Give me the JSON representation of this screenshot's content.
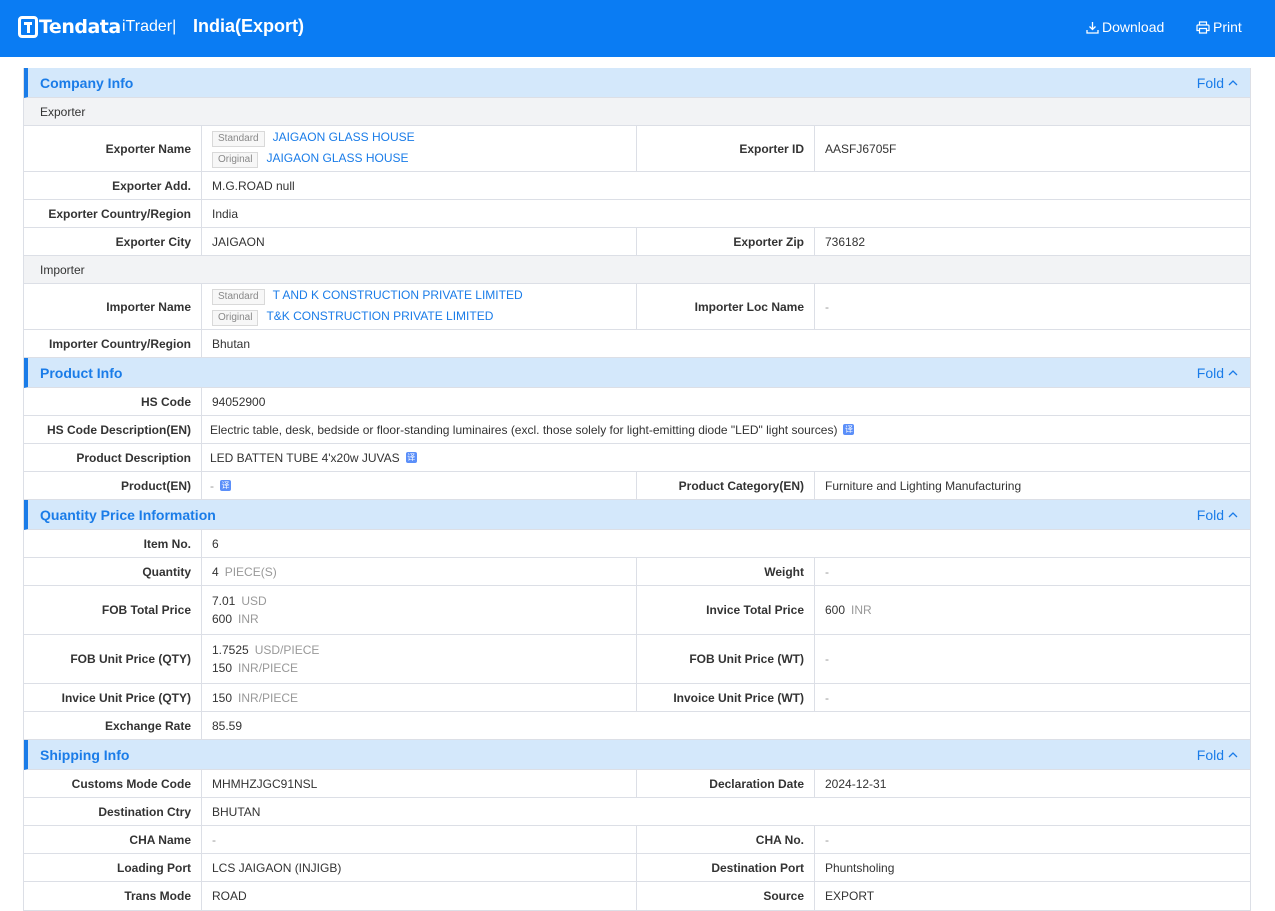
{
  "header": {
    "logo_text": "Tendata",
    "product": "iTrader|",
    "title": "India(Export)",
    "download_label": "Download",
    "print_label": "Print",
    "bar_color": "#0a7cf3"
  },
  "fold_label": "Fold",
  "tag_standard": "Standard",
  "tag_original": "Original",
  "translate_glyph": "译",
  "company": {
    "title": "Company Info",
    "exporter_sub": "Exporter",
    "exporter_name_label": "Exporter Name",
    "exporter_name_std": "JAIGAON GLASS HOUSE",
    "exporter_name_orig": "JAIGAON GLASS HOUSE",
    "exporter_id_label": "Exporter ID",
    "exporter_id": "AASFJ6705F",
    "exporter_add_label": "Exporter Add.",
    "exporter_add": "M.G.ROAD null",
    "exporter_country_label": "Exporter Country/Region",
    "exporter_country": "India",
    "exporter_city_label": "Exporter City",
    "exporter_city": "JAIGAON",
    "exporter_zip_label": "Exporter Zip",
    "exporter_zip": "736182",
    "importer_sub": "Importer",
    "importer_name_label": "Importer Name",
    "importer_name_std": "T AND K CONSTRUCTION PRIVATE LIMITED",
    "importer_name_orig": "T&K CONSTRUCTION PRIVATE LIMITED",
    "importer_loc_label": "Importer Loc Name",
    "importer_loc": "-",
    "importer_country_label": "Importer Country/Region",
    "importer_country": "Bhutan"
  },
  "product": {
    "title": "Product Info",
    "hs_code_label": "HS Code",
    "hs_code": "94052900",
    "hs_desc_label": "HS Code Description(EN)",
    "hs_desc": "Electric table, desk, bedside or floor-standing luminaires (excl. those solely for light-emitting diode \"LED\" light sources)",
    "prod_desc_label": "Product Description",
    "prod_desc": "LED BATTEN TUBE 4'x20w JUVAS",
    "product_en_label": "Product(EN)",
    "product_en": "-",
    "category_label": "Product Category(EN)",
    "category": "Furniture and Lighting Manufacturing"
  },
  "quantity": {
    "title": "Quantity Price Information",
    "item_no_label": "Item No.",
    "item_no": "6",
    "quantity_label": "Quantity",
    "quantity": "4",
    "quantity_unit": "PIECE(S)",
    "weight_label": "Weight",
    "weight": "-",
    "fob_total_label": "FOB Total Price",
    "fob_total_usd": "7.01",
    "fob_total_usd_unit": "USD",
    "fob_total_inr": "600",
    "fob_total_inr_unit": "INR",
    "invoice_total_label": "Invice Total Price",
    "invoice_total": "600",
    "invoice_total_unit": "INR",
    "fob_unit_qty_label": "FOB Unit Price (QTY)",
    "fob_unit_qty_usd": "1.7525",
    "fob_unit_qty_usd_unit": "USD/PIECE",
    "fob_unit_qty_inr": "150",
    "fob_unit_qty_inr_unit": "INR/PIECE",
    "fob_unit_wt_label": "FOB Unit Price (WT)",
    "fob_unit_wt": "-",
    "invoice_unit_qty_label": "Invice Unit Price (QTY)",
    "invoice_unit_qty": "150",
    "invoice_unit_qty_unit": "INR/PIECE",
    "invoice_unit_wt_label": "Invoice Unit Price (WT)",
    "invoice_unit_wt": "-",
    "exchange_label": "Exchange Rate",
    "exchange": "85.59"
  },
  "shipping": {
    "title": "Shipping Info",
    "customs_label": "Customs Mode Code",
    "customs": "MHMHZJGC91NSL",
    "decl_date_label": "Declaration Date",
    "decl_date": "2024-12-31",
    "dest_ctry_label": "Destination Ctry",
    "dest_ctry": "BHUTAN",
    "cha_name_label": "CHA Name",
    "cha_name": "-",
    "cha_no_label": "CHA No.",
    "cha_no": "-",
    "loading_port_label": "Loading Port",
    "loading_port": "LCS JAIGAON (INJIGB)",
    "dest_port_label": "Destination Port",
    "dest_port": "Phuntsholing",
    "trans_mode_label": "Trans Mode",
    "trans_mode": "ROAD",
    "source_label": "Source",
    "source": "EXPORT"
  }
}
